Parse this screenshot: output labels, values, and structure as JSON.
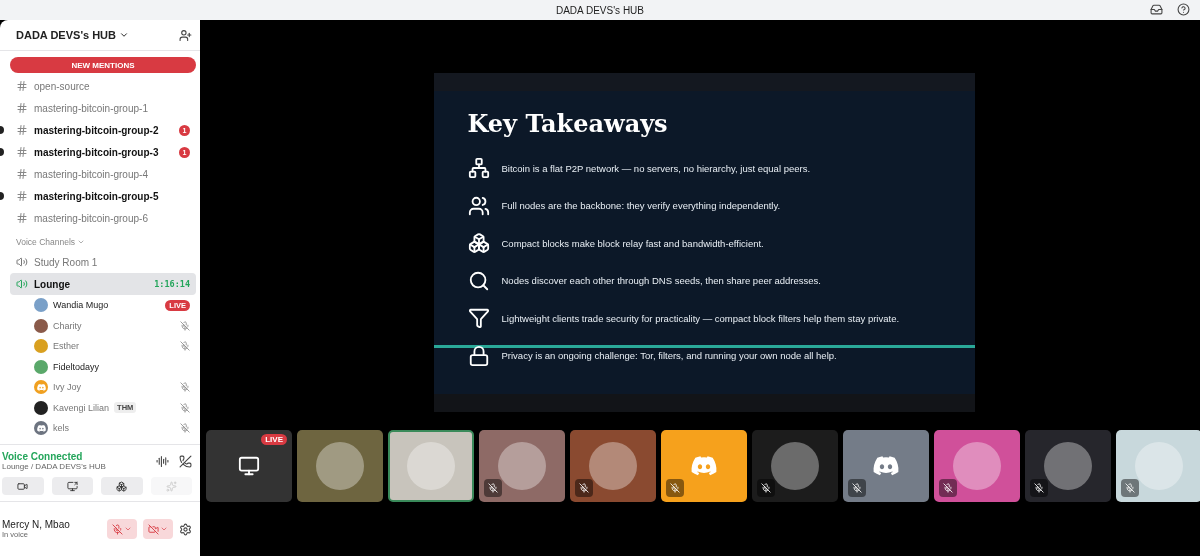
{
  "window": {
    "title": "DADA DEVS's HUB"
  },
  "server": {
    "name": "DADA DEVS's HUB",
    "banner": "NEW MENTIONS"
  },
  "channels": [
    {
      "name": "open-source",
      "unread": false
    },
    {
      "name": "mastering-bitcoin-group-1",
      "unread": false
    },
    {
      "name": "mastering-bitcoin-group-2",
      "unread": true,
      "mentions": "1"
    },
    {
      "name": "mastering-bitcoin-group-3",
      "unread": true,
      "mentions": "1"
    },
    {
      "name": "mastering-bitcoin-group-4",
      "unread": false
    },
    {
      "name": "mastering-bitcoin-group-5",
      "unread": true
    },
    {
      "name": "mastering-bitcoin-group-6",
      "unread": false
    }
  ],
  "voice_section": "Voice Channels",
  "voice_channels": [
    {
      "name": "Study Room 1",
      "selected": false
    },
    {
      "name": "Lounge",
      "selected": true,
      "time": "1:16:14"
    }
  ],
  "members": [
    {
      "name": "Wandia Mugo",
      "live": true,
      "live_label": "LIVE",
      "muted": false,
      "kind": "photo",
      "color": "#7aa0c8"
    },
    {
      "name": "Charity",
      "live": false,
      "muted": true,
      "kind": "photo",
      "color": "#8a5a4a"
    },
    {
      "name": "Esther",
      "live": false,
      "muted": true,
      "kind": "photo",
      "color": "#d9a020"
    },
    {
      "name": "Fideltodayy",
      "live": false,
      "muted": false,
      "kind": "photo",
      "color": "#5aa86a"
    },
    {
      "name": "Ivy Joy",
      "live": false,
      "muted": true,
      "kind": "discord",
      "color": "#f0a020"
    },
    {
      "name": "Kavengi Lilian",
      "tag": "THM",
      "live": false,
      "muted": true,
      "kind": "photo",
      "color": "#222222"
    },
    {
      "name": "kels",
      "live": false,
      "muted": true,
      "kind": "discord",
      "color": "#6d7480"
    }
  ],
  "voice_status": {
    "title": "Voice Connected",
    "location": "Lounge / DADA DEVS's HUB"
  },
  "user": {
    "name": "Mercy N, Mbao",
    "status": "In voice"
  },
  "slide": {
    "title": "Key Takeaways",
    "points": [
      {
        "text": "Bitcoin is a flat P2P network — no servers, no hierarchy, just equal peers."
      },
      {
        "text": "Full nodes are the backbone: they verify everything independently."
      },
      {
        "text": "Compact blocks make block relay fast and bandwidth-efficient."
      },
      {
        "text": "Nodes discover each other through DNS seeds, then share peer addresses."
      },
      {
        "text": "Lightweight clients trade security for practicality — compact block filters help them stay private."
      },
      {
        "text": "Privacy is an ongoing challenge: Tor, filters, and running your own node all help."
      }
    ]
  },
  "tiles": [
    {
      "kind": "stream",
      "live_label": "LIVE",
      "selected": false,
      "muted": false,
      "color": "#333333"
    },
    {
      "kind": "photo",
      "selected": false,
      "muted": false,
      "color": "#6e6540"
    },
    {
      "kind": "photo",
      "selected": true,
      "muted": false,
      "color": "#c8c4bc"
    },
    {
      "kind": "photo",
      "selected": false,
      "muted": true,
      "color": "#8e6a66"
    },
    {
      "kind": "photo",
      "selected": false,
      "muted": true,
      "color": "#8a4a30"
    },
    {
      "kind": "discord",
      "selected": false,
      "muted": true,
      "color": "#f6a11c"
    },
    {
      "kind": "photo",
      "selected": false,
      "muted": true,
      "color": "#1c1c1c"
    },
    {
      "kind": "discord",
      "selected": false,
      "muted": true,
      "color": "#747c88"
    },
    {
      "kind": "photo",
      "selected": false,
      "muted": true,
      "color": "#d0509a"
    },
    {
      "kind": "photo",
      "selected": false,
      "muted": true,
      "color": "#26262c"
    },
    {
      "kind": "photo",
      "selected": false,
      "muted": true,
      "color": "#c8d8dc"
    }
  ]
}
